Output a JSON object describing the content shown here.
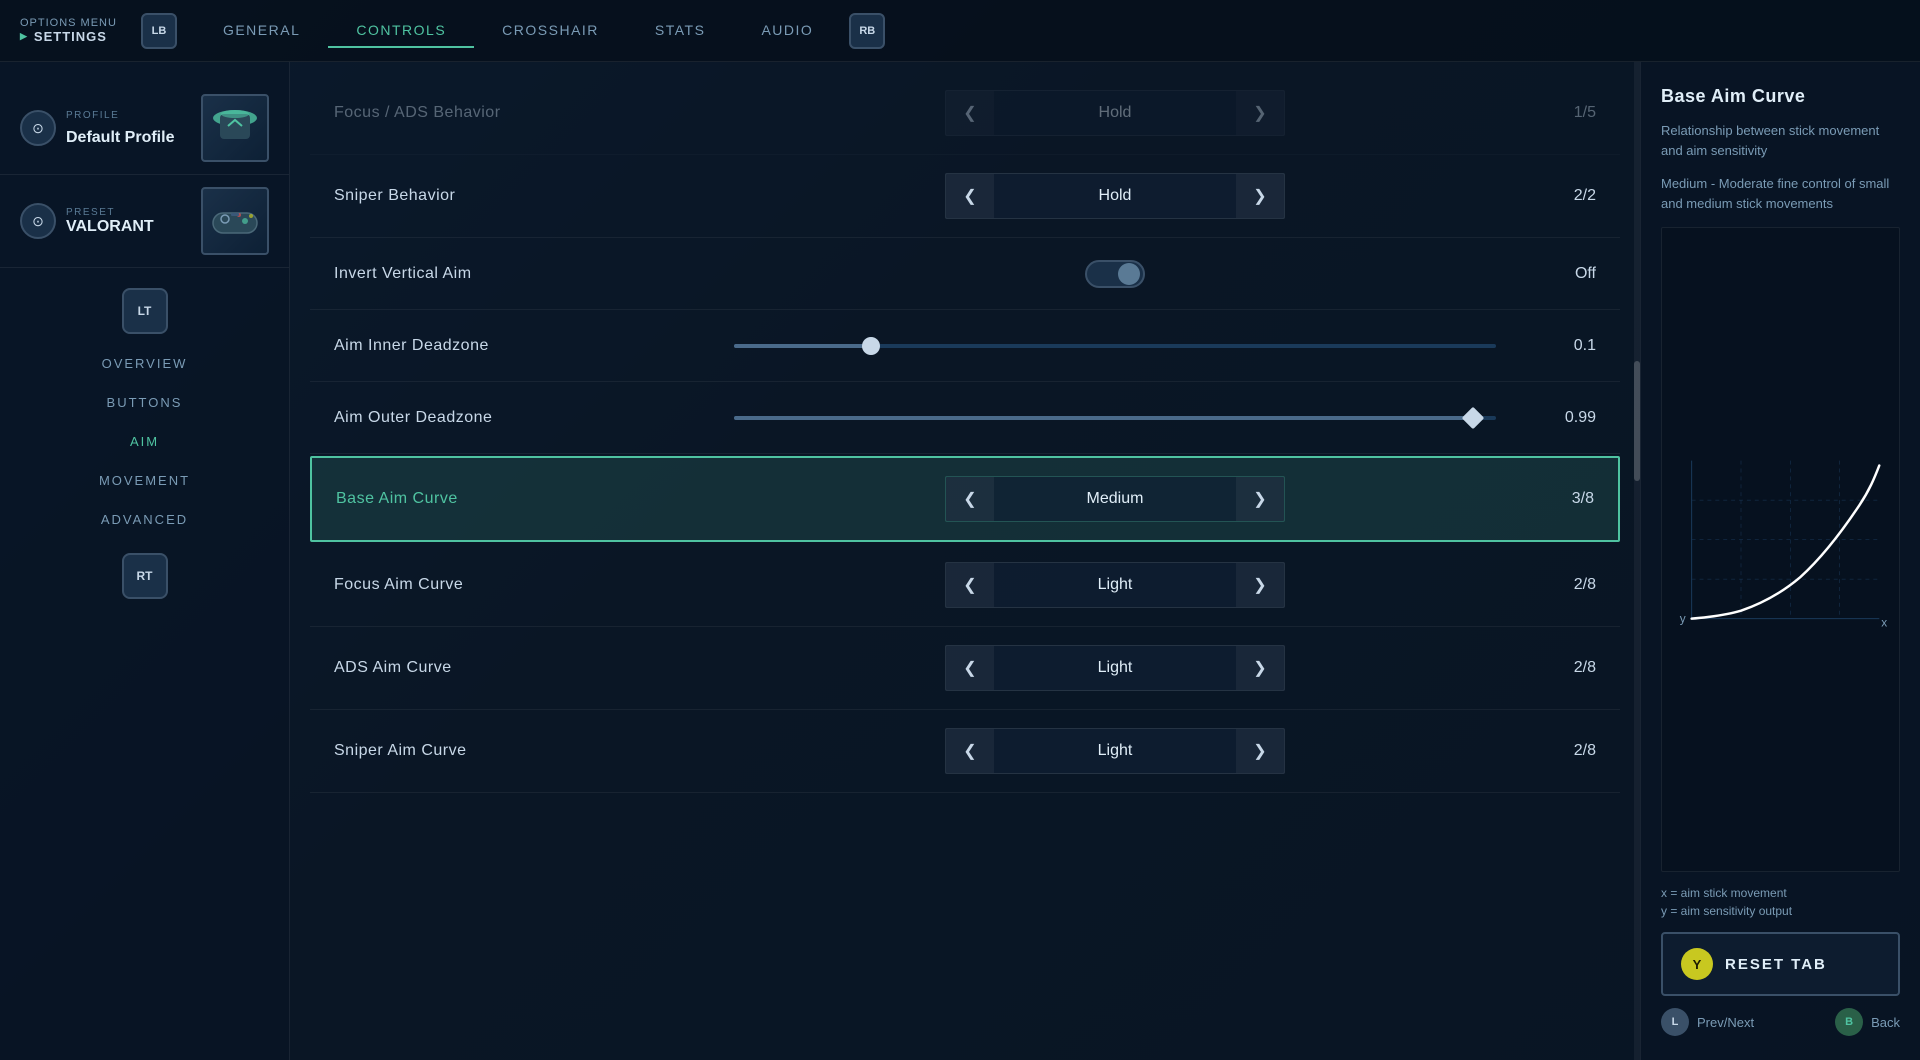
{
  "topNav": {
    "optionsMenuLabel": "OPTIONS MENU",
    "settingsLabel": "SETTINGS",
    "lbLabel": "LB",
    "rbLabel": "RB",
    "tabs": [
      {
        "id": "general",
        "label": "GENERAL",
        "active": false
      },
      {
        "id": "controls",
        "label": "CONTROLS",
        "active": true
      },
      {
        "id": "crosshair",
        "label": "CROSSHAIR",
        "active": false
      },
      {
        "id": "stats",
        "label": "STATS",
        "active": false
      },
      {
        "id": "audio",
        "label": "AUDIO",
        "active": false
      }
    ]
  },
  "sidebar": {
    "profileLabel": "PROFILE",
    "profileName": "Default Profile",
    "presetLabel": "PRESET",
    "presetName": "VALORANT",
    "ltLabel": "LT",
    "rtLabel": "RT",
    "navItems": [
      {
        "id": "overview",
        "label": "OVERVIEW",
        "active": false
      },
      {
        "id": "buttons",
        "label": "BUTTONS",
        "active": false
      },
      {
        "id": "aim",
        "label": "AIM",
        "active": true
      },
      {
        "id": "movement",
        "label": "MOVEMENT",
        "active": false
      },
      {
        "id": "advanced",
        "label": "ADVANCED",
        "active": false
      }
    ]
  },
  "settings": {
    "rows": [
      {
        "id": "focus-ads-behavior",
        "label": "Focus / ADS Behavior",
        "controlType": "selector",
        "value": "Hold",
        "count": "1/5",
        "faded": true
      },
      {
        "id": "sniper-behavior",
        "label": "Sniper Behavior",
        "controlType": "selector",
        "value": "Hold",
        "count": "2/2",
        "faded": false
      },
      {
        "id": "invert-vertical-aim",
        "label": "Invert Vertical Aim",
        "controlType": "toggle",
        "value": "Off",
        "toggleOn": false
      },
      {
        "id": "aim-inner-deadzone",
        "label": "Aim Inner Deadzone",
        "controlType": "slider",
        "value": "0.1",
        "sliderPercent": 18,
        "thumbType": "circle"
      },
      {
        "id": "aim-outer-deadzone",
        "label": "Aim Outer Deadzone",
        "controlType": "slider",
        "value": "0.99",
        "sliderPercent": 97,
        "thumbType": "diamond"
      },
      {
        "id": "base-aim-curve",
        "label": "Base Aim Curve",
        "controlType": "selector",
        "value": "Medium",
        "count": "3/8",
        "highlighted": true
      },
      {
        "id": "focus-aim-curve",
        "label": "Focus Aim Curve",
        "controlType": "selector",
        "value": "Light",
        "count": "2/8"
      },
      {
        "id": "ads-aim-curve",
        "label": "ADS Aim Curve",
        "controlType": "selector",
        "value": "Light",
        "count": "2/8"
      },
      {
        "id": "sniper-aim-curve",
        "label": "Sniper Aim Curve",
        "controlType": "selector",
        "value": "Light",
        "count": "2/8"
      }
    ]
  },
  "rightPanel": {
    "title": "Base Aim Curve",
    "desc1": "Relationship between stick movement and aim sensitivity",
    "desc2": "Medium - Moderate fine control of small and medium stick movements",
    "chartXLabel": "x",
    "chartYLabel": "y",
    "axisXDesc": "x = aim stick movement",
    "axisYDesc": "y = aim sensitivity output",
    "resetTabLabel": "RESET TAB",
    "yBtnLabel": "Y",
    "prevNextLabel": "Prev/Next",
    "backLabel": "Back",
    "lBtnLabel": "L",
    "bBtnLabel": "B"
  }
}
